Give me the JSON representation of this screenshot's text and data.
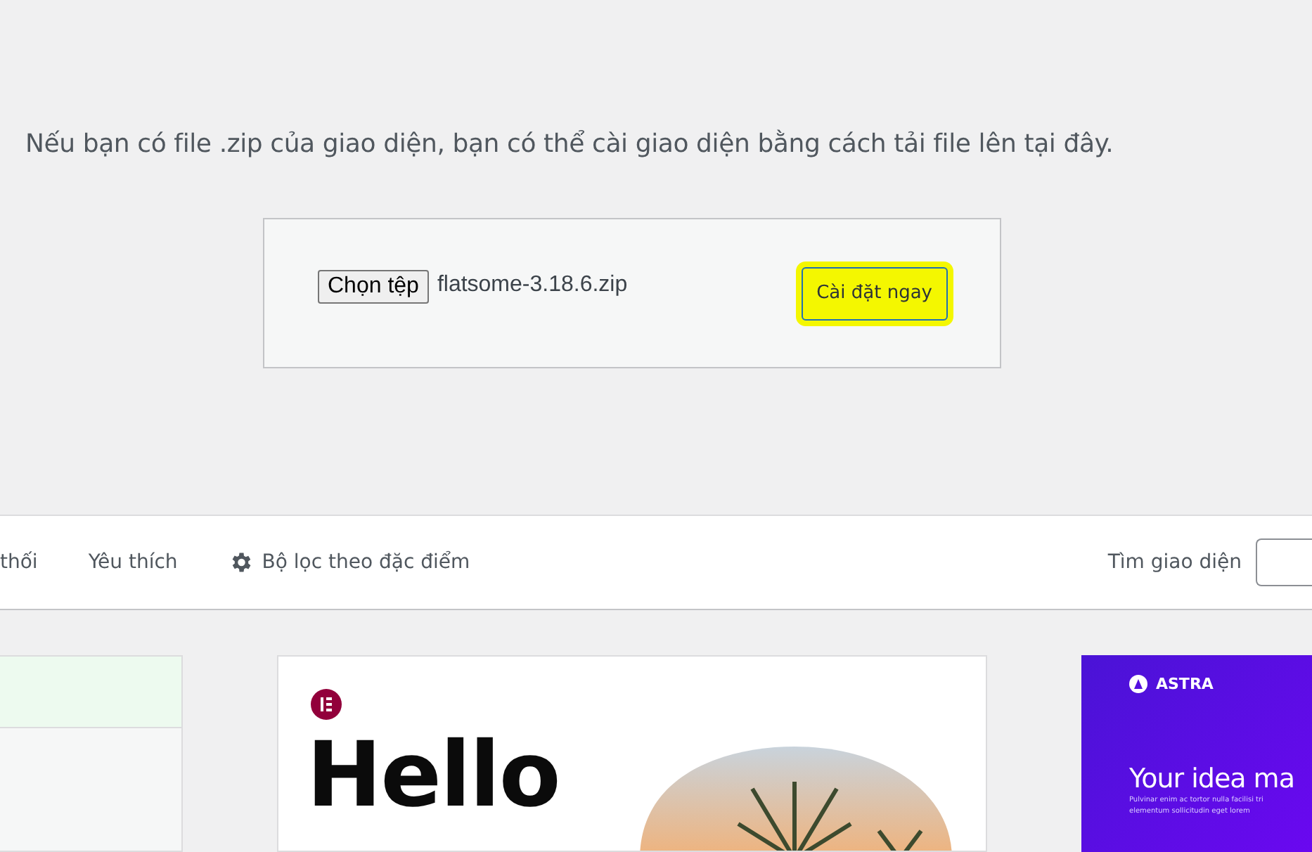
{
  "upload": {
    "instruction": "Nếu bạn có file .zip của giao diện, bạn có thể cài giao diện bằng cách tải file lên tại đây.",
    "file_button": "Chọn tệp",
    "file_name": "flatsome-3.18.6.zip",
    "install_button": "Cài đặt ngay",
    "install_highlighted": true
  },
  "filter_bar": {
    "tabs": [
      {
        "label": "thối",
        "selected": false
      },
      {
        "label": "Yêu thích",
        "selected": false
      }
    ],
    "feature_filter": "Bộ lọc theo đặc điểm",
    "search_label": "Tìm giao diện"
  },
  "themes": [
    {
      "kind": "plain"
    },
    {
      "kind": "hello",
      "heading": "Hello"
    },
    {
      "kind": "astra",
      "brand": "ASTRA",
      "heading": "Your idea ma",
      "body": [
        "Pulvinar enim ac tortor nulla facilisi tri",
        "elementum sollicitudin eget lorem"
      ]
    }
  ]
}
